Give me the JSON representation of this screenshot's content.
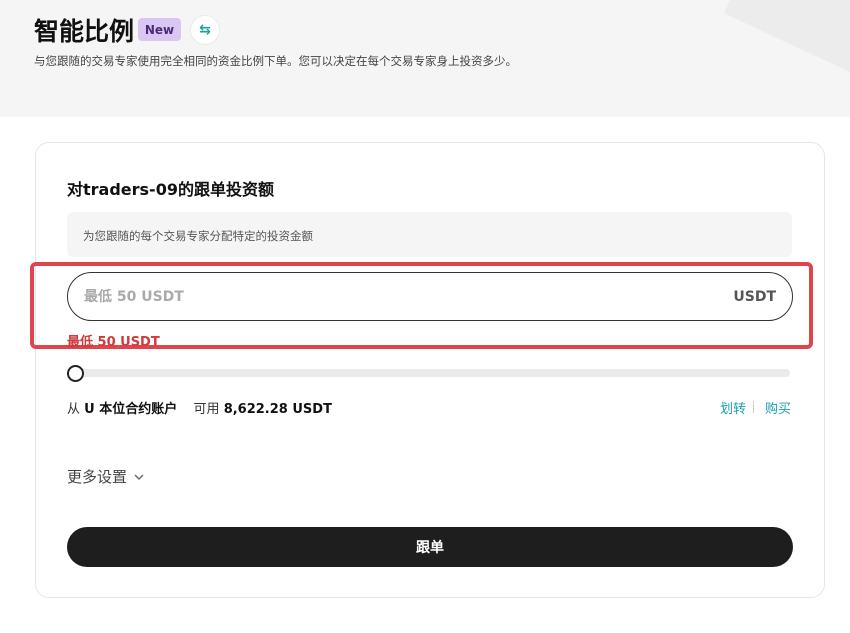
{
  "header": {
    "title": "智能比例",
    "badge": "New",
    "subtitle": "与您跟随的交易专家使用完全相同的资金比例下单。您可以决定在每个交易专家身上投资多少。",
    "swap_icon": "⇆"
  },
  "form": {
    "title": "对traders-09的跟单投资额",
    "hint": "为您跟随的每个交易专家分配特定的投资金额",
    "amount_placeholder": "最低 50 USDT",
    "amount_value": "",
    "unit": "USDT",
    "error": "最低 50 USDT",
    "slider_percent": 0,
    "account": {
      "source_prefix": "从",
      "source_name": "U 本位合约账户",
      "available_label": "可用",
      "available_amount": "8,622.28 USDT"
    },
    "links": {
      "transfer": "划转",
      "buy": "购买"
    },
    "more_settings": "更多设置",
    "submit": "跟单"
  },
  "colors": {
    "accent": "#1aa0ad",
    "error": "#d13a3a",
    "highlight": "#e0444c",
    "badge_bg": "#d9c6f3",
    "button_bg": "#1e1e1e"
  },
  "icons": {
    "swap": "swap-arrows-icon",
    "chevron": "chevron-down-icon"
  }
}
